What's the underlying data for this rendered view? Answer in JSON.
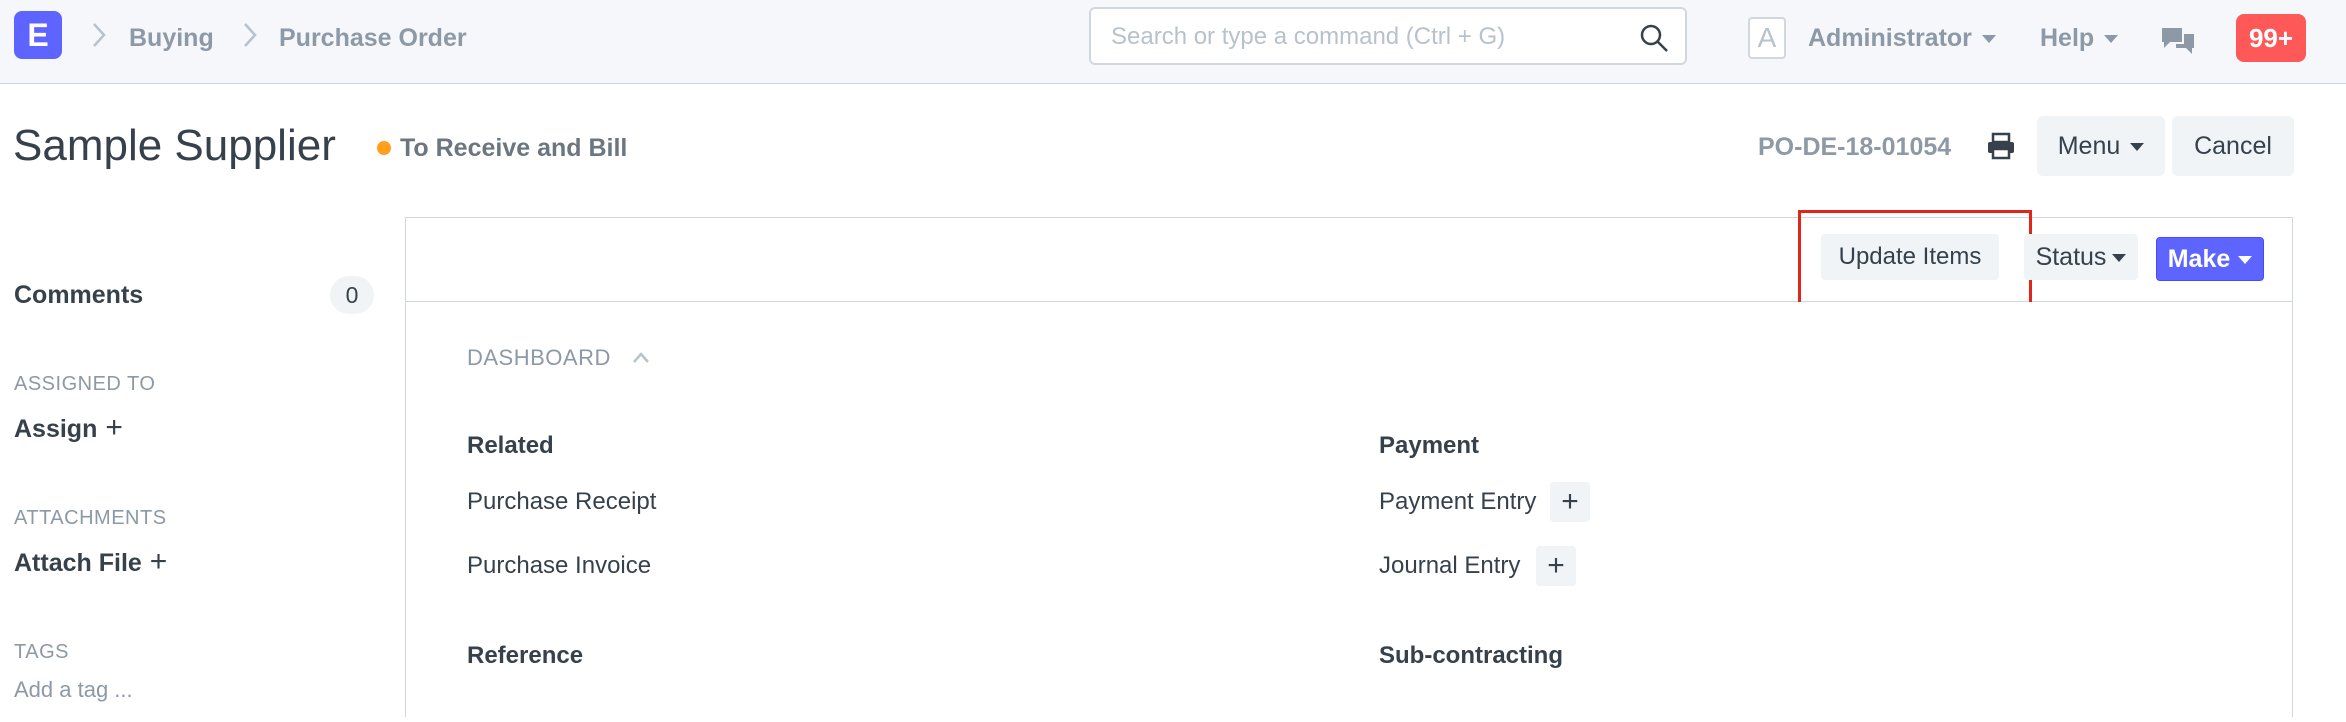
{
  "navbar": {
    "logo": "E",
    "breadcrumbs": [
      "Buying",
      "Purchase Order"
    ],
    "search_placeholder": "Search or type a command (Ctrl + G)",
    "avatar_letter": "A",
    "user_menu": "Administrator",
    "help_menu": "Help",
    "notification_count": "99+"
  },
  "page_head": {
    "title": "Sample Supplier",
    "status": "To Receive and Bill",
    "status_color": "#ff9f1c",
    "doc_name": "PO-DE-18-01054",
    "menu_label": "Menu",
    "cancel_label": "Cancel"
  },
  "sidebar": {
    "comments_label": "Comments",
    "comments_count": "0",
    "assigned_to_label": "ASSIGNED TO",
    "assign_label": "Assign",
    "attachments_label": "ATTACHMENTS",
    "attach_file_label": "Attach File",
    "tags_label": "TAGS",
    "add_tag_label": "Add a tag ..."
  },
  "toolbar": {
    "update_items_label": "Update Items",
    "status_label": "Status",
    "make_label": "Make"
  },
  "dashboard": {
    "title": "DASHBOARD",
    "groups": {
      "related": {
        "heading": "Related",
        "links": [
          "Purchase Receipt",
          "Purchase Invoice"
        ]
      },
      "payment": {
        "heading": "Payment",
        "links": [
          "Payment Entry",
          "Journal Entry"
        ]
      },
      "reference": {
        "heading": "Reference"
      },
      "subcontracting": {
        "heading": "Sub-contracting"
      }
    }
  },
  "colors": {
    "primary": "#5e64ff",
    "notification": "#ff5858",
    "highlight": "#e0261b"
  }
}
